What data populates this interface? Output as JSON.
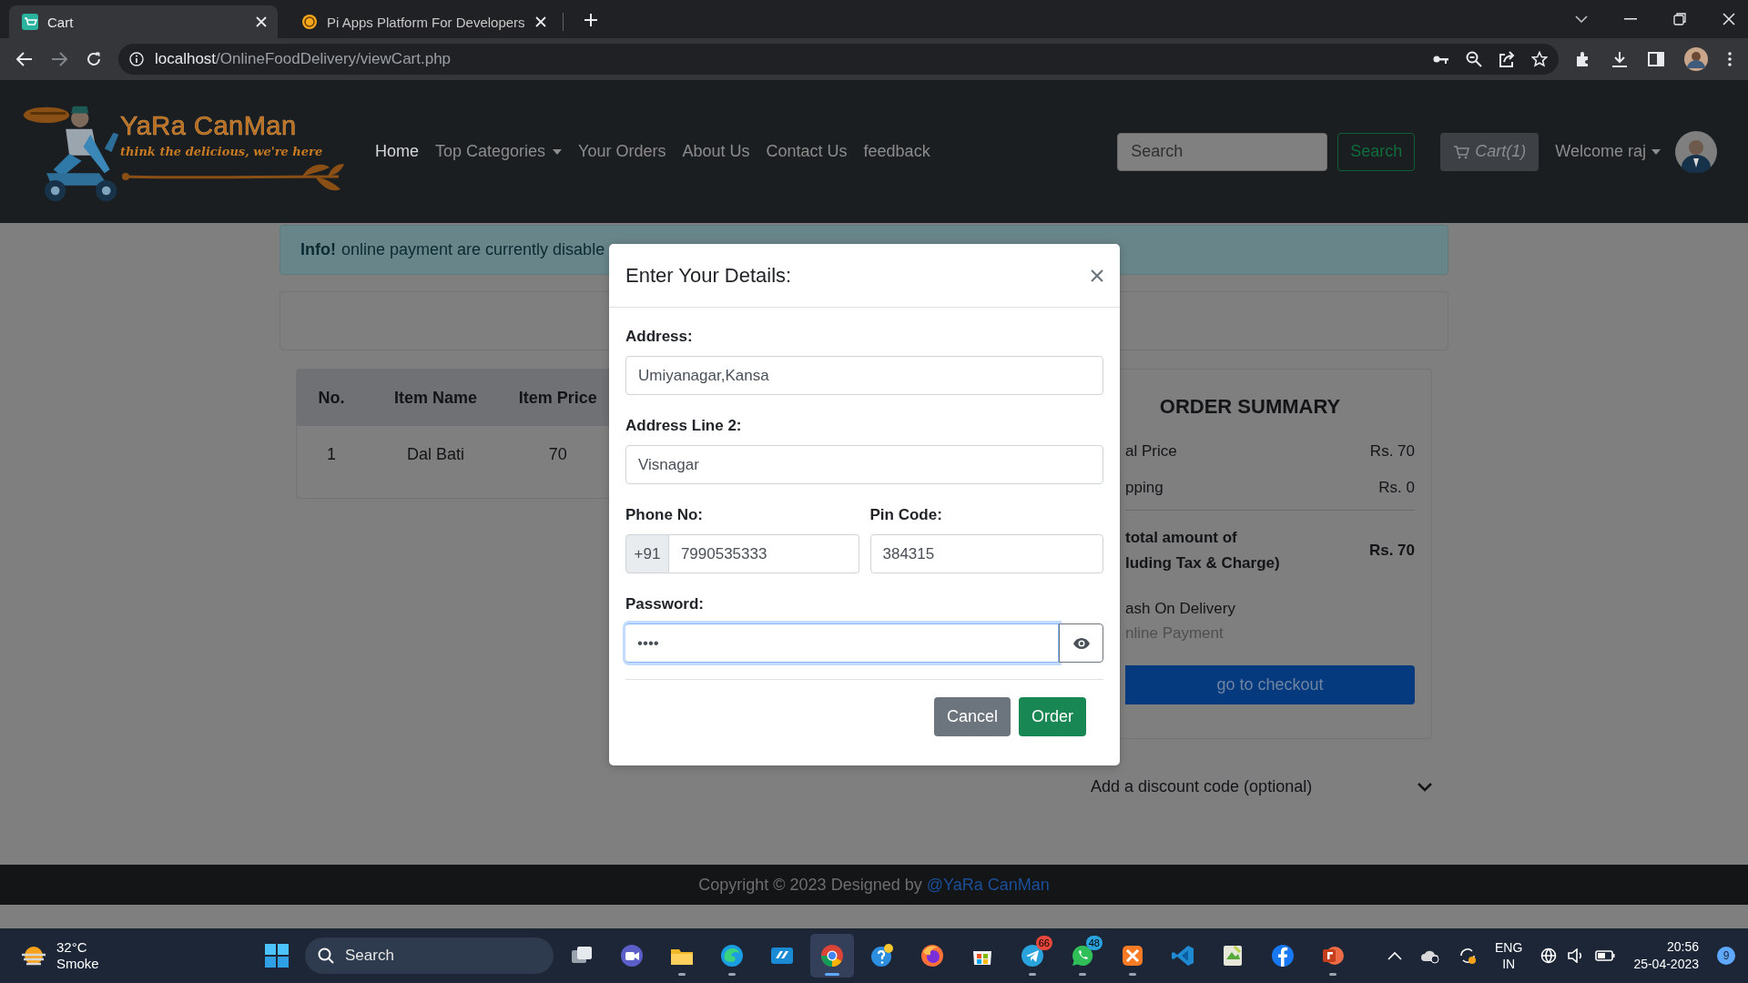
{
  "browser": {
    "tabs": [
      {
        "title": "Cart",
        "selected": true
      },
      {
        "title": "Pi Apps Platform For Developers",
        "selected": false
      }
    ],
    "url_host": "localhost",
    "url_path": "/OnlineFoodDelivery/viewCart.php"
  },
  "navbar": {
    "brand": "YaRa CanMan",
    "tagline": "think the delicious, we're here",
    "links": [
      {
        "label": "Home",
        "selected": true,
        "dropdown": false
      },
      {
        "label": "Top Categories",
        "selected": false,
        "dropdown": true
      },
      {
        "label": "Your Orders",
        "selected": false,
        "dropdown": false
      },
      {
        "label": "About Us",
        "selected": false,
        "dropdown": false
      },
      {
        "label": "Contact Us",
        "selected": false,
        "dropdown": false
      },
      {
        "label": "feedback",
        "selected": false,
        "dropdown": false
      }
    ],
    "search": {
      "placeholder": "Search"
    },
    "search_button": "Search",
    "cart_button": "Cart(1)",
    "user_menu": "Welcome raj"
  },
  "alert": {
    "title": "Info!",
    "text": "online payment are currently disable"
  },
  "cart_table": {
    "columns": [
      "No.",
      "Item Name",
      "Item Price"
    ],
    "rows": [
      [
        "1",
        "Dal Bati",
        "70"
      ]
    ]
  },
  "order_summary": {
    "title": "ORDER SUMMARY",
    "lines": [
      {
        "label": "al Price",
        "value": "Rs. 70"
      },
      {
        "label": "pping",
        "value": "Rs. 0"
      }
    ],
    "total": {
      "label_lines": [
        "total amount of",
        "luding Tax & Charge)"
      ],
      "value": "Rs. 70"
    },
    "payment_options": [
      {
        "label": "ash On Delivery",
        "disabled": false
      },
      {
        "label": "nline Payment",
        "disabled": true
      }
    ],
    "checkout_button": "go to checkout"
  },
  "discount": {
    "label": "Add a discount code (optional)"
  },
  "modal": {
    "title": "Enter Your Details:",
    "address": {
      "label": "Address:",
      "value": "Umiyanagar,Kansa"
    },
    "address2": {
      "label": "Address Line 2:",
      "value": "Visnagar"
    },
    "phone": {
      "label": "Phone No:",
      "prefix": "+91",
      "value": "7990535333"
    },
    "pin": {
      "label": "Pin Code:",
      "value": "384315"
    },
    "password": {
      "label": "Password:",
      "value": "••••",
      "focused": true
    },
    "buttons": [
      {
        "label": "Cancel",
        "kind": "secondary"
      },
      {
        "label": "Order",
        "kind": "primary"
      }
    ]
  },
  "footer": {
    "text": "Copyright © 2023 Designed by",
    "link": "@YaRa CanMan"
  },
  "taskbar": {
    "weather": {
      "temp": "32°C",
      "condition": "Smoke"
    },
    "search": {
      "placeholder": "Search"
    },
    "apps": [
      {
        "kind": "taskview",
        "running": false,
        "active": false
      },
      {
        "kind": "meet",
        "running": false,
        "active": false
      },
      {
        "kind": "files",
        "running": true,
        "active": false
      },
      {
        "kind": "edge",
        "running": true,
        "active": false
      },
      {
        "kind": "myhp",
        "running": false,
        "active": false
      },
      {
        "kind": "chrome",
        "running": true,
        "active": true
      },
      {
        "kind": "help",
        "running": false,
        "active": false
      },
      {
        "kind": "firefox",
        "running": false,
        "active": false
      },
      {
        "kind": "store",
        "running": false,
        "active": false
      },
      {
        "kind": "telegram",
        "running": true,
        "active": false,
        "badge": "66"
      },
      {
        "kind": "whatsapp",
        "running": true,
        "active": false,
        "badge": "48"
      },
      {
        "kind": "xampp",
        "running": true,
        "active": false
      },
      {
        "kind": "vscode",
        "running": false,
        "active": false
      },
      {
        "kind": "notepad",
        "running": false,
        "active": false
      },
      {
        "kind": "facebook",
        "running": false,
        "active": false
      },
      {
        "kind": "powerpoint",
        "running": true,
        "active": false
      }
    ],
    "tray": {
      "language": "ENG",
      "region": "IN",
      "time": "20:56",
      "date": "25-04-2023",
      "notifications": "9"
    }
  }
}
